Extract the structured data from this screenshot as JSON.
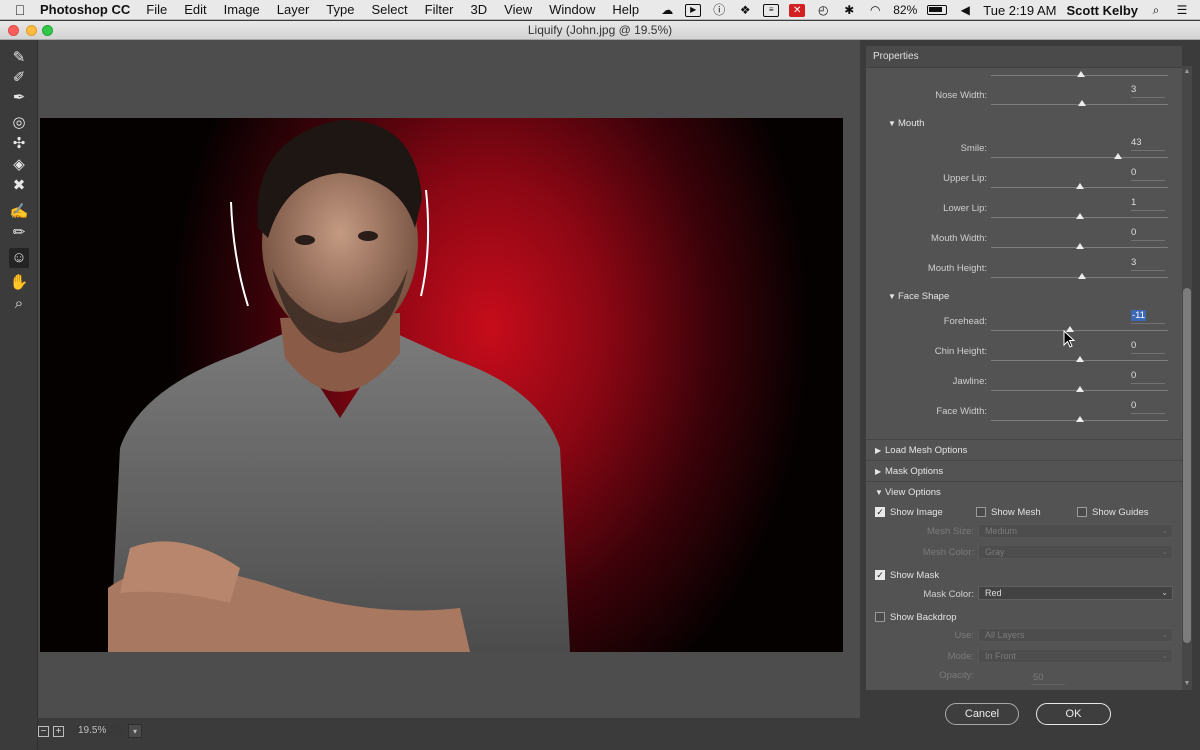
{
  "menubar": {
    "app_name": "Photoshop CC",
    "menus": [
      "File",
      "Edit",
      "Image",
      "Layer",
      "Type",
      "Select",
      "Filter",
      "3D",
      "View",
      "Window",
      "Help"
    ],
    "battery": "82%",
    "clock": "Tue 2:19 AM",
    "user": "Scott Kelby"
  },
  "window": {
    "title": "Liquify (John.jpg @ 19.5%)"
  },
  "toolbar": {
    "tools": [
      "forward-warp-tool",
      "reconstruct-tool",
      "smooth-tool",
      "twirl-clockwise-tool",
      "pucker-tool",
      "bloat-tool",
      "push-left-tool",
      "freeze-mask-tool",
      "thaw-mask-tool",
      "face-tool",
      "hand-tool",
      "zoom-tool"
    ],
    "active_tool": "face-tool"
  },
  "canvas": {
    "zoom": "19.5%"
  },
  "panel": {
    "title": "Properties",
    "nose_width": {
      "label": "Nose Width:",
      "value": "3",
      "level": 3
    },
    "mouth": {
      "title": "Mouth",
      "smile": {
        "label": "Smile:",
        "value": "43",
        "level": 43
      },
      "upper_lip": {
        "label": "Upper Lip:",
        "value": "0",
        "level": 0
      },
      "lower_lip": {
        "label": "Lower Lip:",
        "value": "1",
        "level": 1
      },
      "mouth_width": {
        "label": "Mouth Width:",
        "value": "0",
        "level": 0
      },
      "mouth_height": {
        "label": "Mouth Height:",
        "value": "3",
        "level": 3
      }
    },
    "face_shape": {
      "title": "Face Shape",
      "forehead": {
        "label": "Forehead:",
        "value": "-11",
        "level": -11
      },
      "chin_height": {
        "label": "Chin Height:",
        "value": "0",
        "level": 0
      },
      "jawline": {
        "label": "Jawline:",
        "value": "0",
        "level": 0
      },
      "face_width": {
        "label": "Face Width:",
        "value": "0",
        "level": 0
      }
    },
    "load_mesh_options": "Load Mesh Options",
    "mask_options": "Mask Options",
    "view_options": {
      "title": "View Options",
      "show_image": "Show Image",
      "show_mesh": "Show Mesh",
      "show_guides": "Show Guides",
      "mesh_size_label": "Mesh Size:",
      "mesh_size_value": "Medium",
      "mesh_color_label": "Mesh Color:",
      "mesh_color_value": "Gray",
      "show_mask": "Show Mask",
      "mask_color_label": "Mask Color:",
      "mask_color_value": "Red",
      "show_backdrop": "Show Backdrop",
      "use_label": "Use:",
      "use_value": "All Layers",
      "mode_label": "Mode:",
      "mode_value": "In Front",
      "opacity_label": "Opacity:",
      "opacity_value": "50"
    }
  },
  "buttons": {
    "cancel": "Cancel",
    "ok": "OK"
  },
  "colors": {
    "background_red": "#c70c1b",
    "shirt_gray": "#6e6e6e"
  }
}
